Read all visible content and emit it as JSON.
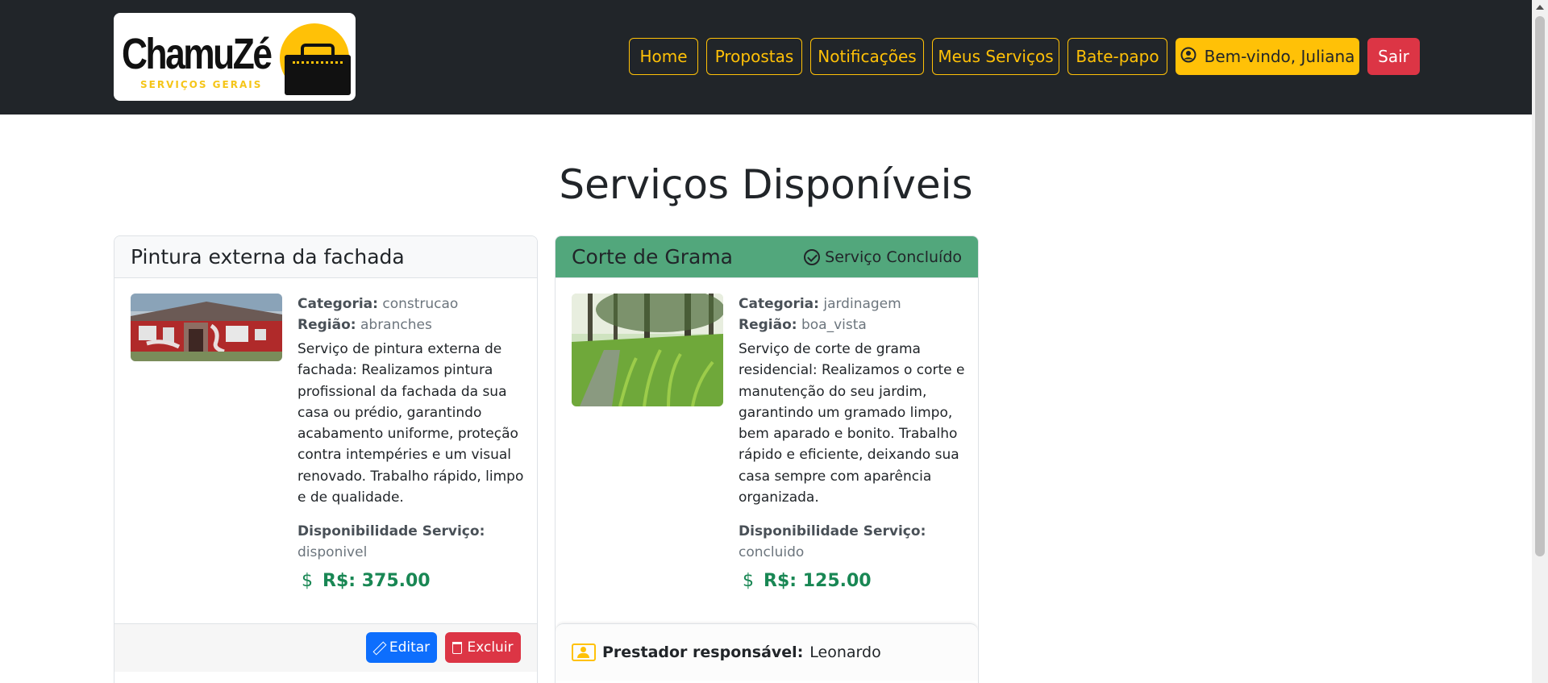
{
  "brand": {
    "logo_name": "ChamuZé",
    "logo_tagline": "SERVIÇOS GERAIS"
  },
  "nav": {
    "items": [
      {
        "label": "Home"
      },
      {
        "label": "Propostas"
      },
      {
        "label": "Notificações"
      },
      {
        "label": "Meus Serviços"
      },
      {
        "label": "Bate-papo"
      }
    ],
    "welcome_label": "Bem-vindo, Juliana",
    "logout_label": "Sair"
  },
  "page": {
    "title": "Serviços Disponíveis"
  },
  "labels": {
    "category": "Categoria:",
    "region": "Região:",
    "availability": "Disponibilidade Serviço:",
    "edit": "Editar",
    "delete": "Excluir",
    "provider": "Prestador responsável:",
    "completed_badge": "Serviço Concluído"
  },
  "services": [
    {
      "title": "Pintura externa da fachada",
      "category": "construcao",
      "region": "abranches",
      "description": "Serviço de pintura externa de fachada: Realizamos pintura profissional da fachada da sua casa ou prédio, garantindo acabamento uniforme, proteção contra intempéries e um visual renovado. Trabalho rápido, limpo e de qualidade.",
      "availability": "disponivel",
      "price": "R$: 375.00"
    },
    {
      "title": "Corte de Grama",
      "category": "jardinagem",
      "region": "boa_vista",
      "description": "Serviço de corte de grama residencial: Realizamos o corte e manutenção do seu jardim, garantindo um gramado limpo, bem aparado e bonito. Trabalho rápido e eficiente, deixando sua casa sempre com aparência organizada.",
      "availability": "concluido",
      "price": "R$: 125.00",
      "provider": "Leonardo"
    }
  ],
  "colors": {
    "navbar": "#212529",
    "accent": "#ffc107",
    "danger": "#dc3545",
    "primary": "#0d6efd",
    "success": "#198754",
    "completed_header": "#52a77c"
  },
  "icons": {
    "welcome": "person-circle-icon",
    "completed": "check-circle-icon",
    "price": "dollar-icon",
    "edit": "pencil-icon",
    "delete": "trash-icon",
    "provider": "person-badge-icon"
  }
}
